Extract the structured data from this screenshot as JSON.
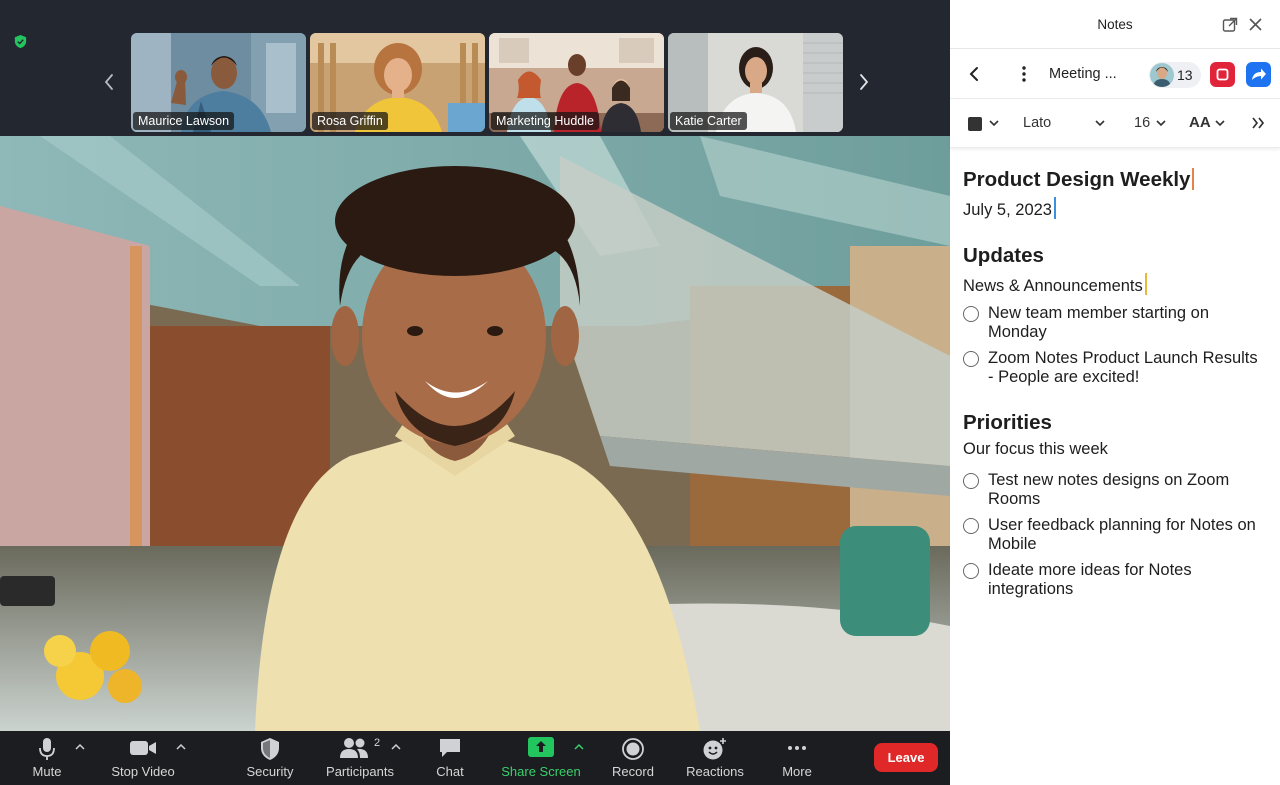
{
  "thumbnails": [
    {
      "name": "Maurice Lawson"
    },
    {
      "name": "Rosa Griffin"
    },
    {
      "name": "Marketing Huddle"
    },
    {
      "name": "Katie Carter"
    }
  ],
  "toolbar": {
    "mute": "Mute",
    "stop_video": "Stop Video",
    "security": "Security",
    "participants": "Participants",
    "participants_count": "2",
    "chat": "Chat",
    "share_screen": "Share Screen",
    "record": "Record",
    "reactions": "Reactions",
    "more": "More",
    "leave": "Leave"
  },
  "colors": {
    "share_green": "#22c55e",
    "leave_red": "#e02828",
    "stop_red": "#e0243a",
    "share_blue": "#1e73f0"
  },
  "notes": {
    "title": "Notes",
    "doc_name": "Meeting ...",
    "collaborator_count": "13",
    "font": "Lato",
    "font_size": "16",
    "text_size_icon": "AA",
    "heading": "Product Design Weekly",
    "date": "July 5, 2023",
    "sections": [
      {
        "title": "Updates",
        "subtitle": "News & Announcements",
        "tasks": [
          "New team member starting on Monday",
          "Zoom Notes Product Launch Results - People are excited!"
        ]
      },
      {
        "title": "Priorities",
        "subtitle": "Our focus this week",
        "tasks": [
          "Test new notes designs on Zoom Rooms",
          "User feedback planning for Notes on Mobile",
          "Ideate more ideas for Notes integrations"
        ]
      }
    ]
  }
}
